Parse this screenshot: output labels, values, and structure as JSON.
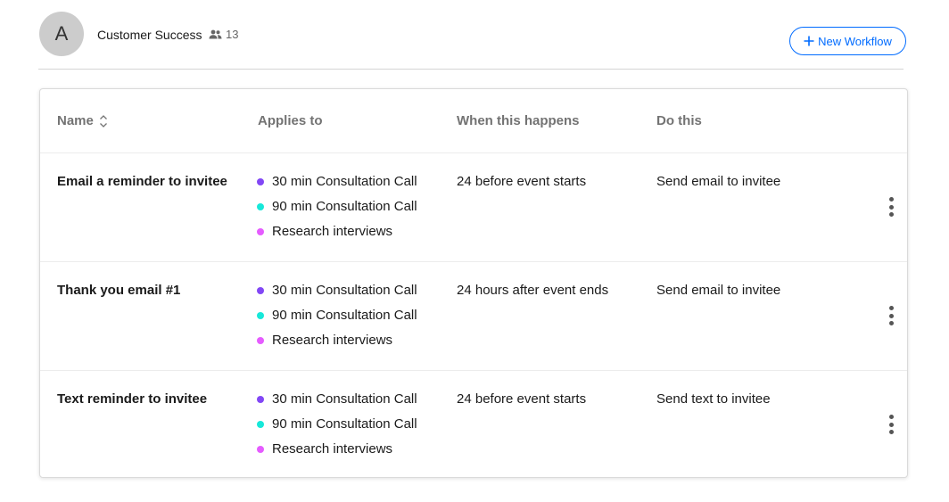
{
  "team": {
    "avatar_initial": "A",
    "name": "Customer Success",
    "member_icon": "people-icon",
    "member_count": "13"
  },
  "toolbar": {
    "new_workflow_icon": "plus-icon",
    "new_workflow_label": "New Workflow"
  },
  "table": {
    "columns": {
      "name": "Name",
      "applies_to": "Applies to",
      "when": "When this happens",
      "do": "Do this"
    },
    "sort_icon": "sort-chevrons-icon",
    "rows": [
      {
        "name": "Email a reminder to invitee",
        "events": [
          {
            "label": "30 min Consultation Call",
            "color": "#8247f5"
          },
          {
            "label": "90 min Consultation Call",
            "color": "#17e8d9"
          },
          {
            "label": "Research interviews",
            "color": "#e55cff"
          }
        ],
        "when": "24 before event starts",
        "action": "Send email to invitee",
        "menu_icon": "more-vertical-icon"
      },
      {
        "name": "Thank you email #1",
        "events": [
          {
            "label": "30 min Consultation Call",
            "color": "#8247f5"
          },
          {
            "label": "90 min Consultation Call",
            "color": "#17e8d9"
          },
          {
            "label": "Research interviews",
            "color": "#e55cff"
          }
        ],
        "when": "24 hours after event ends",
        "action": "Send email to invitee",
        "menu_icon": "more-vertical-icon"
      },
      {
        "name": "Text reminder to invitee",
        "events": [
          {
            "label": "30 min Consultation Call",
            "color": "#8247f5"
          },
          {
            "label": "90 min Consultation Call",
            "color": "#17e8d9"
          },
          {
            "label": "Research interviews",
            "color": "#e55cff"
          }
        ],
        "when": "24 before event starts",
        "action": "Send text to invitee",
        "menu_icon": "more-vertical-icon"
      }
    ]
  },
  "colors": {
    "accent": "#006bff",
    "avatar_bg": "#cccccc"
  }
}
